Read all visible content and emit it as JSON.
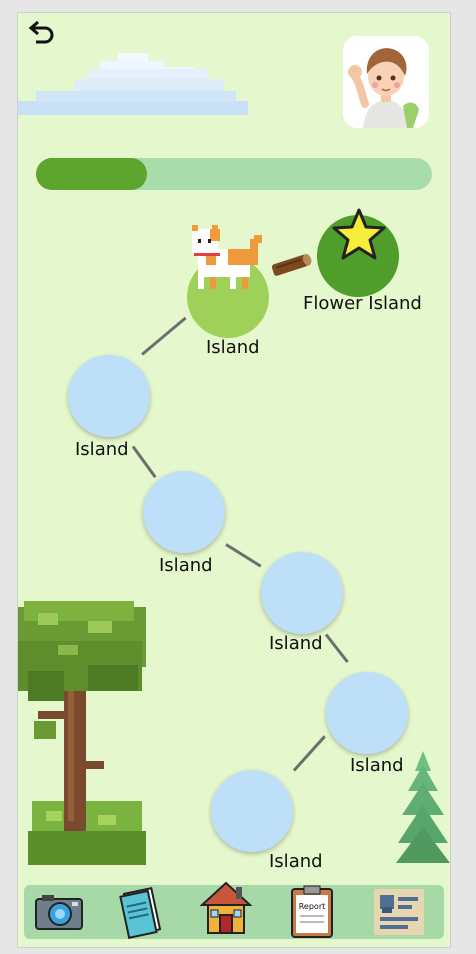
{
  "progress": {
    "value": 0.28
  },
  "islands": [
    {
      "id": "current",
      "label": "Island"
    },
    {
      "id": "flower",
      "label": "Flower Island"
    },
    {
      "id": "island2",
      "label": "Island"
    },
    {
      "id": "island3",
      "label": "Island"
    },
    {
      "id": "island4",
      "label": "Island"
    },
    {
      "id": "island5",
      "label": "Island"
    },
    {
      "id": "island6",
      "label": "Island"
    }
  ],
  "nav": {
    "items": [
      {
        "name": "camera",
        "icon": "camera-icon"
      },
      {
        "name": "notebook",
        "icon": "notebook-icon"
      },
      {
        "name": "home",
        "icon": "house-icon"
      },
      {
        "name": "report",
        "icon": "report-clipboard-icon",
        "label": "Report"
      },
      {
        "name": "profile-card",
        "icon": "id-card-icon"
      }
    ]
  },
  "colors": {
    "background": "#e5f7cc",
    "progress_track": "#a8dcaa",
    "progress_fill": "#5da52c",
    "node": "#bde0f8",
    "current_node": "#9fd15a",
    "star_node": "#4f9e2b",
    "nav_bar": "#a7d9a8"
  }
}
